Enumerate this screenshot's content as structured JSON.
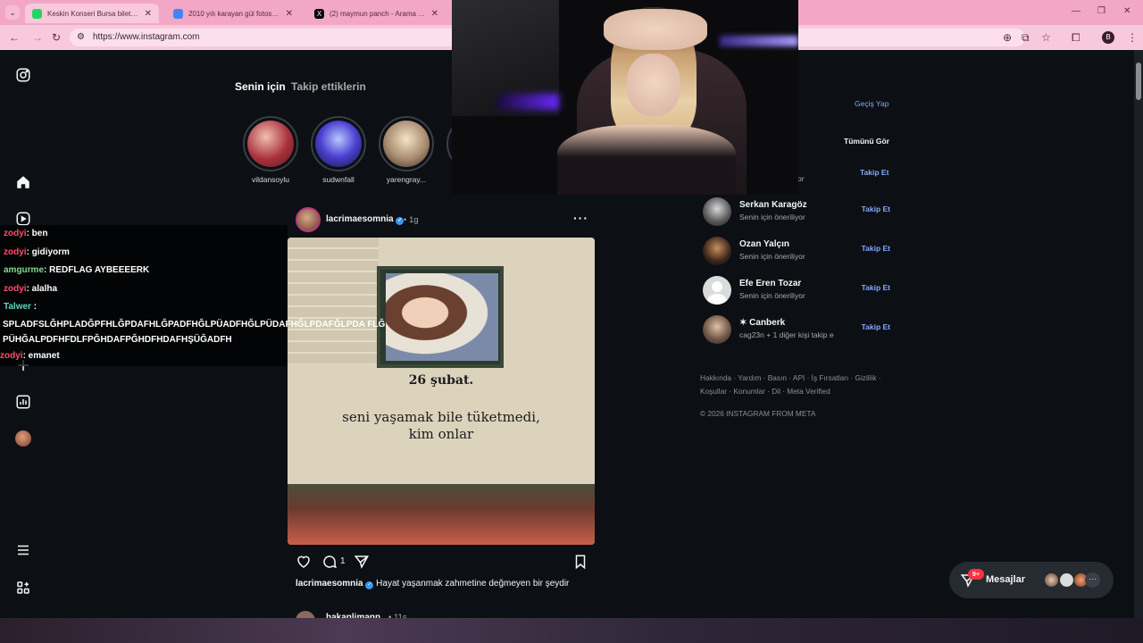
{
  "browser": {
    "tabs": [
      {
        "title": "Keskin Konseri Bursa biletleri | ",
        "favicon_color": "#25d366"
      },
      {
        "title": "2010 yılı karayan gül fotosu - ",
        "favicon_color": "#4285f4"
      },
      {
        "title": "(2) maymun panch - Arama / X",
        "favicon_color": "#000000"
      }
    ],
    "url": "https://www.instagram.com",
    "profile_initial": "B"
  },
  "feed": {
    "tabs": {
      "for_you": "Senin için",
      "following": "Takip ettiklerin"
    },
    "stories": [
      {
        "name": "vildansoylu"
      },
      {
        "name": "sudwnfall"
      },
      {
        "name": "yarengray..."
      }
    ]
  },
  "post": {
    "username": "lacrimaesomnia",
    "time": "1g",
    "image_date": "26 şubat.",
    "image_quote": "seni yaşamak bile tüketmedi, kim onlar",
    "comment_count": "1",
    "caption_user": "lacrimaesomnia",
    "caption_text": "Hayat yaşanmak zahmetine değmeyen bir şeydir",
    "next_user": "hakanlimann",
    "next_time": "11s"
  },
  "right": {
    "switch_label": "Geçiş Yap",
    "see_all_label": "Tümünü Gör",
    "partial_sub": "or",
    "follow_label": "Takip Et",
    "suggestions": [
      {
        "name": "Serkan Karagöz",
        "sub": "Senin için öneriliyor"
      },
      {
        "name": "Ozan Yalçın",
        "sub": "Senin için öneriliyor"
      },
      {
        "name": "Efe Eren Tozar",
        "sub": "Senin için öneriliyor"
      },
      {
        "name": "✶ Canberk",
        "sub": "cag23n + 1 diğer kişi takip e"
      }
    ],
    "footer_links": "Hakkında · Yardım · Basın · API · İş Fırsatları · Gizlilik · Koşullar · Konumlar · Dil · Meta Verified",
    "copyright": "© 2026 INSTAGRAM FROM META"
  },
  "messages": {
    "label": "Mesajlar",
    "badge": "9+"
  },
  "chat": {
    "lines": [
      {
        "user": "zodyi",
        "text": ": ben",
        "color": "#ff4d6d"
      },
      {
        "user": "zodyi",
        "text": ": gidiyorm",
        "color": "#ff4d6d"
      },
      {
        "user": "amgurme",
        "text": ": REDFLAG AYBEEEERK",
        "color": "#7fdc8a"
      },
      {
        "user": "zodyi",
        "text": ": alalha",
        "color": "#ff4d6d"
      },
      {
        "user": "Talwer",
        "text": " :",
        "color": "#5fd6c0"
      },
      {
        "user": "zodyi",
        "text": ": emanet",
        "color": "#ff4d6d"
      }
    ],
    "long_message": "SPLADFSLĞHPLADĞPFHLĞPDAFHLĞPADFHĞLPÜADFHĞLPÜDAFHĞLPDAFĞLPDA FLĞPÜHĞALPDFHFDLFPĞHDAFPĞHDFHDAFHŞÜĞADFH"
  },
  "colors": {
    "page_bg": "#0c0f14",
    "link_blue": "#85a8ff",
    "browser_pink": "#f2a7c6"
  }
}
